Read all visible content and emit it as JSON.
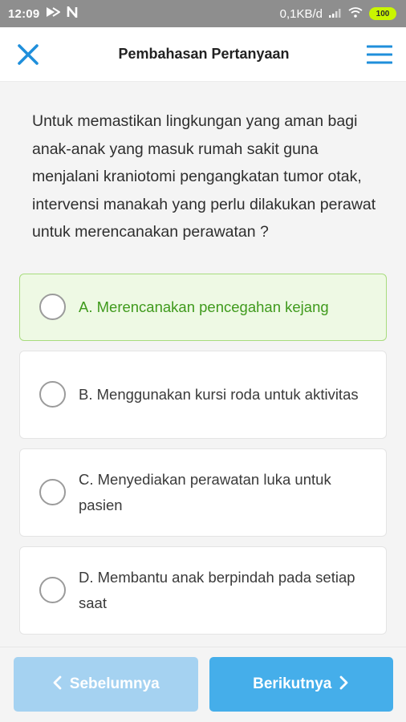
{
  "status_bar": {
    "time": "12:09",
    "network": "0,1KB/d",
    "battery": "100"
  },
  "header": {
    "title": "Pembahasan Pertanyaan",
    "close_icon": "close-icon",
    "menu_icon": "hamburger-menu-icon"
  },
  "question": {
    "text": "Untuk memastikan lingkungan yang aman bagi anak-anak yang masuk rumah sakit guna menjalani kraniotomi pengangkatan tumor otak, intervensi manakah yang perlu dilakukan perawat untuk merencanakan perawatan ?"
  },
  "options": [
    {
      "label": "A. Merencanakan pencegahan kejang",
      "state": "correct"
    },
    {
      "label": "B. Menggunakan kursi roda untuk aktivitas",
      "state": "default"
    },
    {
      "label": "C. Menyediakan perawatan luka untuk pasien",
      "state": "default"
    },
    {
      "label": "D. Membantu anak berpindah pada setiap saat",
      "state": "default"
    }
  ],
  "footer": {
    "prev_label": "Sebelumnya",
    "next_label": "Berikutnya"
  },
  "colors": {
    "accent": "#45aeea",
    "accent_disabled": "#a5d2f1",
    "correct_text": "#3f9a1c",
    "correct_bg": "#eef9e4"
  }
}
